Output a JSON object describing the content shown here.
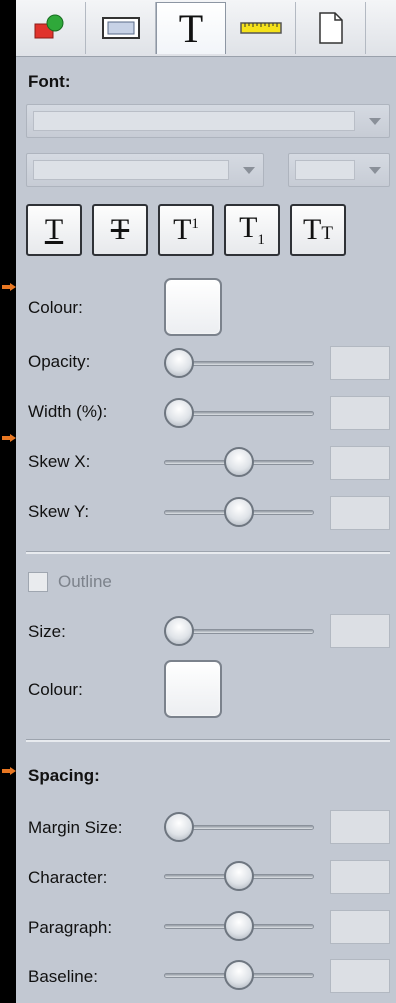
{
  "tabs": [
    {
      "id": "shape",
      "icon": "shape-fill-icon"
    },
    {
      "id": "border",
      "icon": "rectangle-icon"
    },
    {
      "id": "text",
      "icon": "text-t-icon",
      "glyph": "T",
      "active": true
    },
    {
      "id": "ruler",
      "icon": "ruler-icon"
    },
    {
      "id": "page",
      "icon": "page-icon"
    }
  ],
  "font": {
    "heading": "Font:",
    "buttons": [
      {
        "name": "underline",
        "glyph": "T"
      },
      {
        "name": "strikethrough",
        "glyph": "T"
      },
      {
        "name": "superscript",
        "glyph": "T",
        "sub": "1"
      },
      {
        "name": "subscript",
        "glyph": "T",
        "sub": "1"
      },
      {
        "name": "small-caps",
        "glyph": "T",
        "sub": "T"
      }
    ]
  },
  "text_props": {
    "colour_label": "Colour:",
    "opacity_label": "Opacity:",
    "width_label": "Width (%):",
    "skew_x_label": "Skew X:",
    "skew_y_label": "Skew Y:",
    "opacity_level": 0,
    "width_level": 0,
    "skew_x_level": 0.5,
    "skew_y_level": 0.5
  },
  "outline": {
    "checkbox_label": "Outline",
    "checked": false,
    "size_label": "Size:",
    "size_level": 0,
    "colour_label": "Colour:"
  },
  "spacing": {
    "heading": "Spacing:",
    "margin_label": "Margin Size:",
    "character_label": "Character:",
    "paragraph_label": "Paragraph:",
    "baseline_label": "Baseline:",
    "margin_level": 0,
    "character_level": 0.5,
    "paragraph_level": 0.5,
    "baseline_level": 0.5
  },
  "colors": {
    "panel_bg": "#c2c8d2",
    "arrow": "#e87722"
  }
}
